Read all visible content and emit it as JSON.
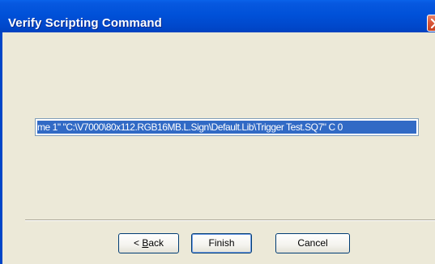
{
  "window": {
    "title": "Verify Scripting Command",
    "close_icon": "close-icon"
  },
  "command": {
    "value": "me 1\" \"C:\\V7000\\80x112.RGB16MB.L.Sign\\Default.Lib\\Trigger Test.SQ7\" C 0",
    "selected": true
  },
  "buttons": {
    "back_prefix": "< ",
    "back_accel": "B",
    "back_rest": "ack",
    "finish_label": "Finish",
    "cancel_label": "Cancel"
  },
  "colors": {
    "titlebar": "#0051d8",
    "dialog_bg": "#ece9d8",
    "selection": "#316ac5",
    "close_button": "#d9583a"
  }
}
